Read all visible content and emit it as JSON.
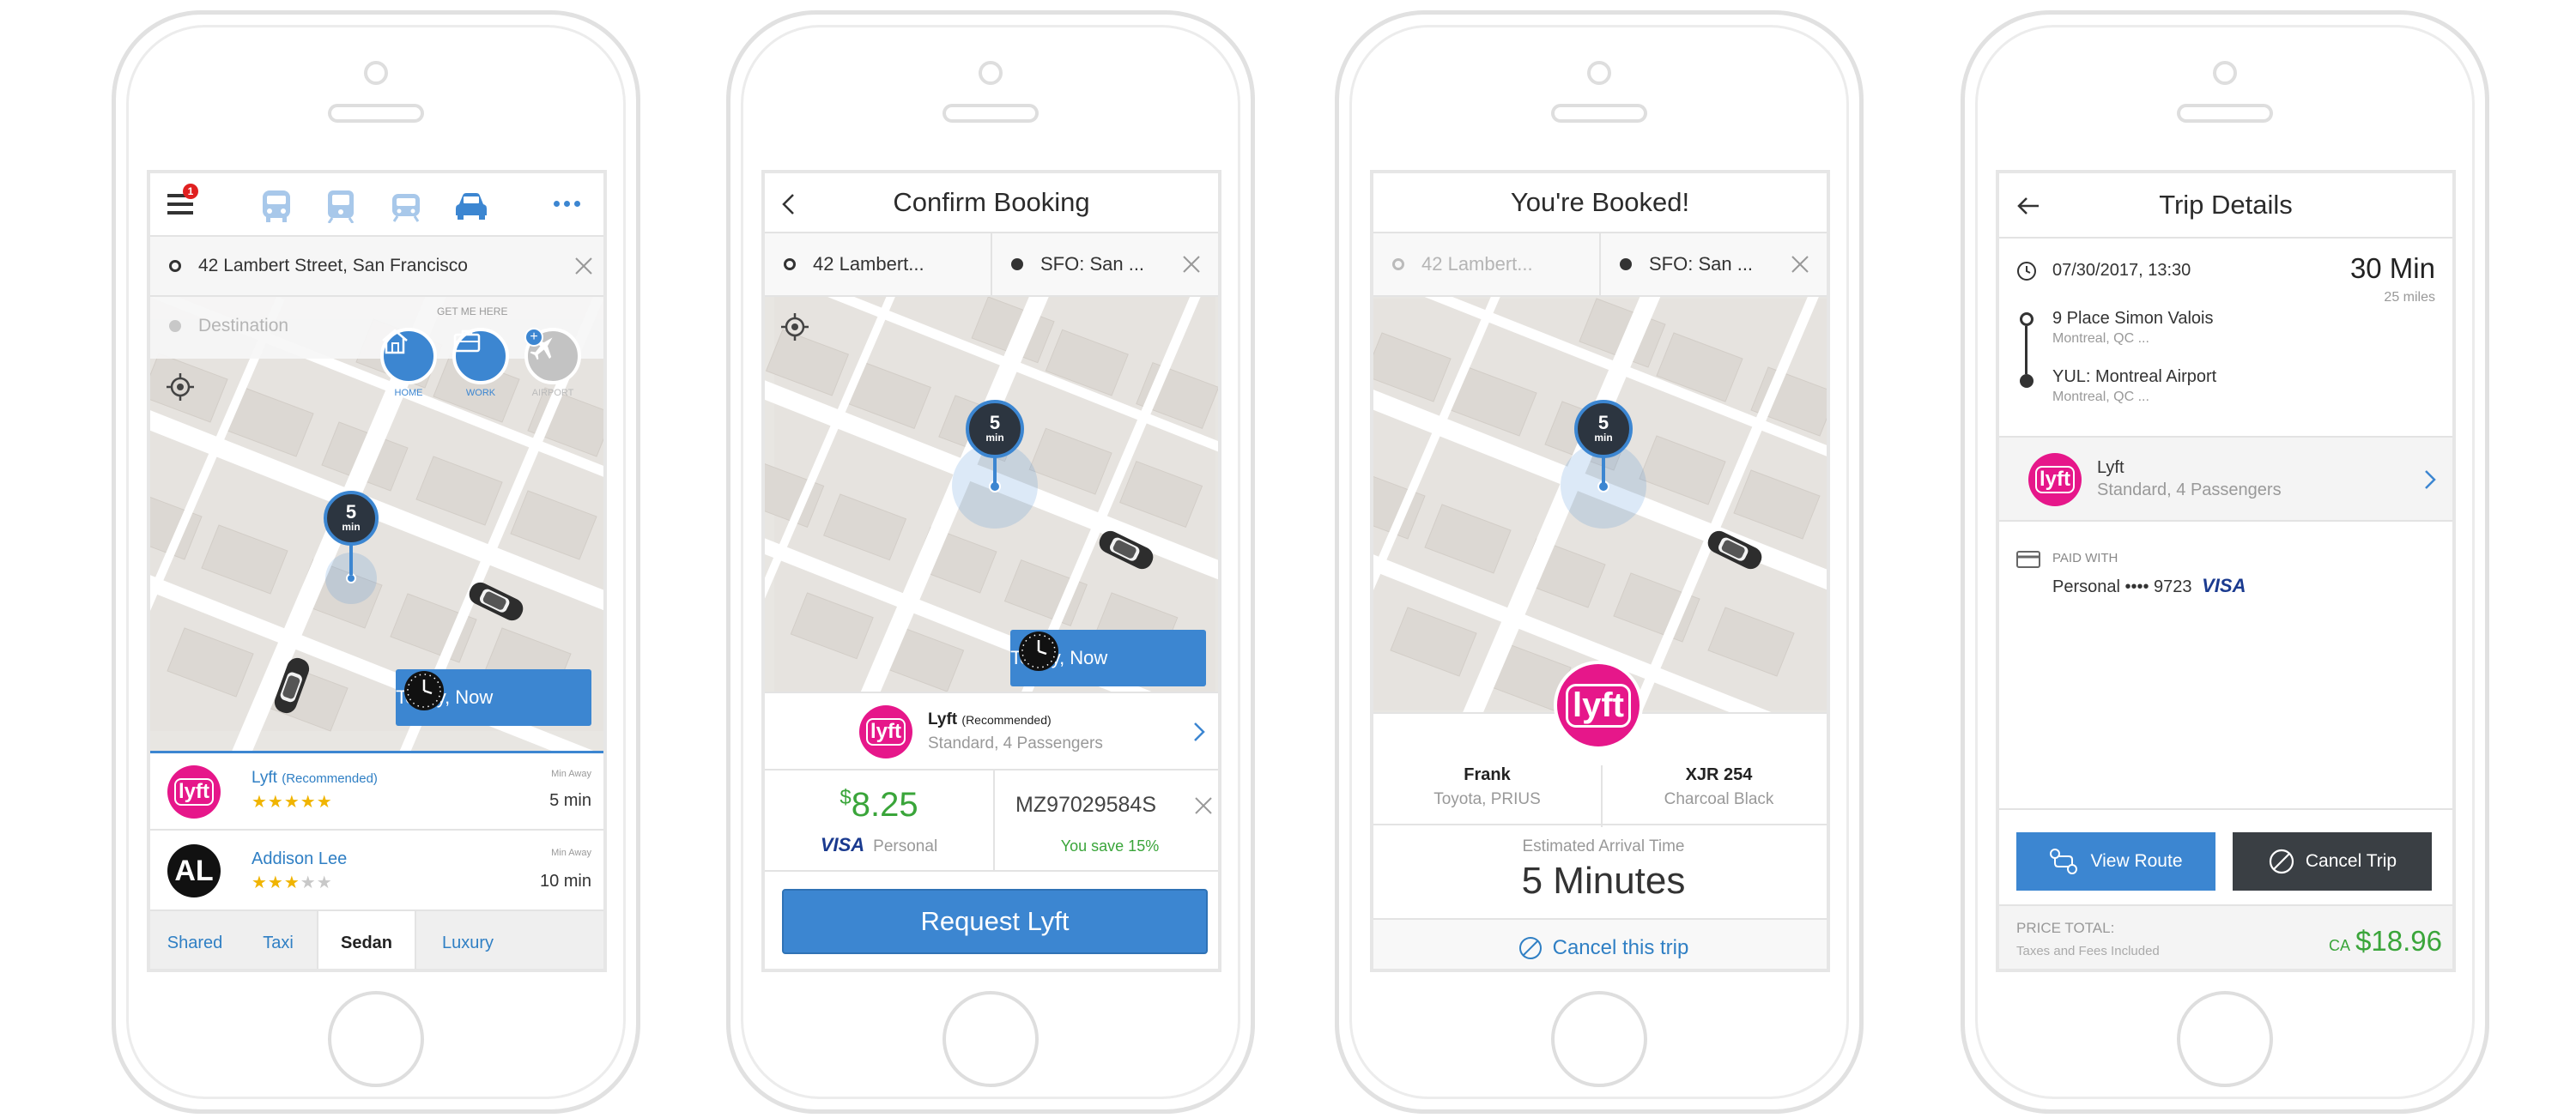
{
  "screen1": {
    "origin_address": "42 Lambert Street, San Francisco",
    "destination_placeholder": "Destination",
    "get_me_here": "GET ME HERE",
    "notification_count": "1",
    "shortcuts": [
      {
        "label": "HOME",
        "icon": "home-icon"
      },
      {
        "label": "WORK",
        "icon": "briefcase-icon"
      },
      {
        "label": "AIRPORT",
        "icon": "airplane-icon"
      }
    ],
    "pin_eta_number": "5",
    "pin_eta_unit": "min",
    "time_button": "Today, Now",
    "providers": [
      {
        "name": "Lyft",
        "tag": "(Recommended)",
        "away_label": "Min Away",
        "eta": "5 min",
        "rating": 5
      },
      {
        "name": "Addison Lee",
        "tag": "",
        "away_label": "Min Away",
        "eta": "10 min",
        "rating": 3
      }
    ],
    "tabs": [
      "Shared",
      "Taxi",
      "Sedan",
      "Luxury"
    ],
    "active_tab": "Sedan"
  },
  "screen2": {
    "title": "Confirm Booking",
    "origin": "42 Lambert...",
    "destination": "SFO: San ...",
    "pin_eta_number": "5",
    "pin_eta_unit": "min",
    "time_button": "Today, Now",
    "ride_name": "Lyft",
    "ride_tag": "(Recommended)",
    "ride_sub": "Standard, 4 Passengers",
    "price_symbol": "$",
    "price": "8.25",
    "card_brand": "VISA",
    "card_type": "Personal",
    "promo_code": "MZ97029584S",
    "promo_savings": "You save 15%",
    "request_button": "Request Lyft"
  },
  "screen3": {
    "title": "You're Booked!",
    "origin": "42 Lambert...",
    "destination": "SFO: San ...",
    "pin_eta_number": "5",
    "pin_eta_unit": "min",
    "logo_text": "lyft",
    "driver_name": "Frank",
    "car_model": "Toyota, PRIUS",
    "plate": "XJR 254",
    "car_color": "Charcoal Black",
    "eta_label": "Estimated Arrival Time",
    "eta_value": "5 Minutes",
    "cancel_label": "Cancel this trip"
  },
  "screen4": {
    "title": "Trip Details",
    "datetime": "07/30/2017, 13:30",
    "duration": "30 Min",
    "distance": "25 miles",
    "stops": [
      {
        "name": "9 Place Simon Valois",
        "sub": "Montreal, QC ..."
      },
      {
        "name": "YUL: Montreal Airport",
        "sub": "Montreal, QC ..."
      }
    ],
    "ride_name": "Lyft",
    "ride_sub": "Standard, 4 Passengers",
    "paid_with_label": "PAID WITH",
    "payment": "Personal •••• 9723",
    "card_brand": "VISA",
    "view_route_button": "View Route",
    "cancel_trip_button": "Cancel Trip",
    "price_total_label": "PRICE TOTAL:",
    "taxes_note": "Taxes and Fees Included",
    "currency": "CA",
    "total": "$18.96"
  },
  "colors": {
    "lyft_pink": "#e6178a",
    "primary_blue": "#3c86d1",
    "link_blue": "#2f7fc4",
    "dark_button": "#3a3f44",
    "price_green": "#3aa53a",
    "star_yellow": "#f0b400"
  }
}
